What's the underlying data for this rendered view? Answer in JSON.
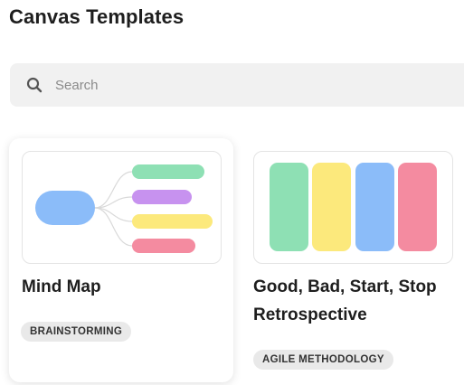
{
  "header": {
    "title": "Canvas Templates"
  },
  "search": {
    "placeholder": "Search",
    "icon": "search-icon"
  },
  "templates": [
    {
      "title": "Mind Map",
      "tag": "BRAINSTORMING",
      "preview": {
        "node_color": "#8bbcf9",
        "branch_colors": [
          "#8ee0b4",
          "#c792ef",
          "#fce97c",
          "#f48ba0"
        ]
      }
    },
    {
      "title": "Good, Bad, Start, Stop Retrospective",
      "tag": "AGILE METHODOLOGY",
      "preview": {
        "column_colors": [
          "#8ee0b4",
          "#fce97c",
          "#8bbcf9",
          "#f48ba0"
        ]
      }
    }
  ]
}
